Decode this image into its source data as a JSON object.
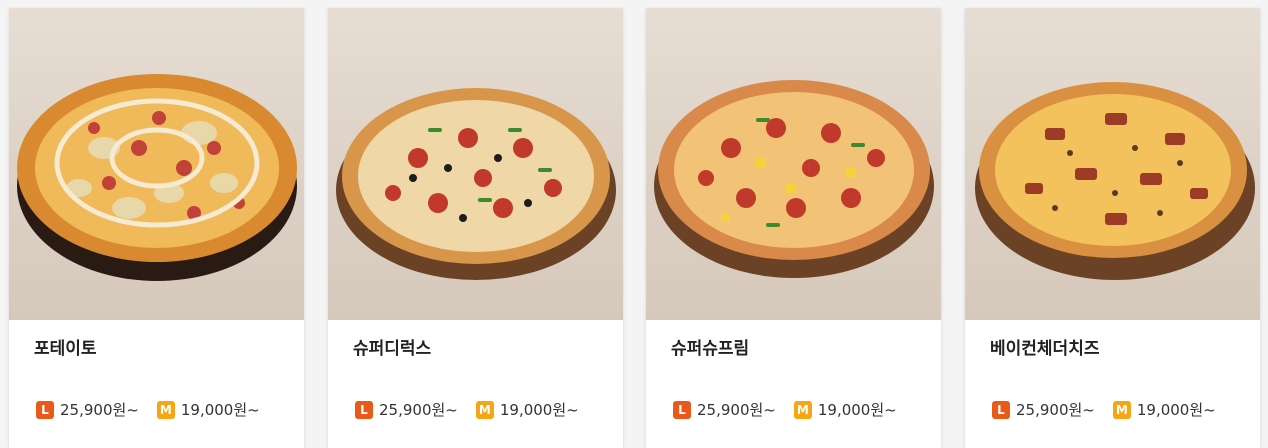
{
  "menu": [
    {
      "name": "포테이토",
      "size_l": {
        "badge": "L",
        "price": "25,900원~"
      },
      "size_m": {
        "badge": "M",
        "price": "19,000원~"
      }
    },
    {
      "name": "슈퍼디럭스",
      "size_l": {
        "badge": "L",
        "price": "25,900원~"
      },
      "size_m": {
        "badge": "M",
        "price": "19,000원~"
      }
    },
    {
      "name": "슈퍼슈프림",
      "size_l": {
        "badge": "L",
        "price": "25,900원~"
      },
      "size_m": {
        "badge": "M",
        "price": "19,000원~"
      }
    },
    {
      "name": "베이컨체더치즈",
      "size_l": {
        "badge": "L",
        "price": "25,900원~"
      },
      "size_m": {
        "badge": "M",
        "price": "19,000원~"
      }
    }
  ],
  "colors": {
    "badge_l": "#e8591a",
    "badge_m": "#f5a515"
  }
}
